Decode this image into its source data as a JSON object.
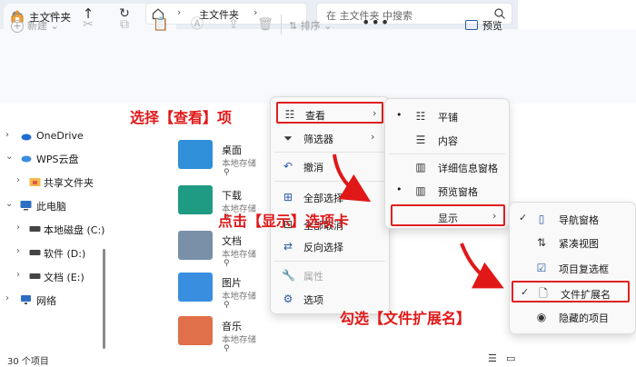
{
  "window": {
    "tab_title": "主文件夹",
    "tab_close": "✕",
    "new_tab": "+",
    "min": "—",
    "max": "☐",
    "close": "✕"
  },
  "address": {
    "back": "←",
    "forward": "→",
    "up": "↑",
    "refresh": "↻",
    "separator": "›",
    "breadcrumb": "主文件夹",
    "search_placeholder": "在 主文件夹 中搜索"
  },
  "toolbar": {
    "new_label": "新建",
    "new_caret": "⌄",
    "sort_label": "排序",
    "sort_caret": "⌄",
    "more": "•••",
    "preview_label": "预览"
  },
  "sidebar": {
    "items": [
      {
        "label": "OneDrive",
        "chevron": "›"
      },
      {
        "label": "WPS云盘",
        "chevron": "⌄"
      },
      {
        "label": "共享文件夹",
        "chevron": "›"
      },
      {
        "label": "此电脑",
        "chevron": "⌄"
      },
      {
        "label": "本地磁盘 (C:)",
        "chevron": "›"
      },
      {
        "label": "软件 (D:)",
        "chevron": "›"
      },
      {
        "label": "文档 (E:)",
        "chevron": "›"
      },
      {
        "label": "网络",
        "chevron": "›"
      }
    ]
  },
  "files": [
    {
      "name": "桌面",
      "location": "本地存储",
      "pin": "📌",
      "color": "#2f8fd8"
    },
    {
      "name": "下载",
      "location": "本地存储",
      "pin": "📌",
      "color": "#1f9a83"
    },
    {
      "name": "文档",
      "location": "本地存储",
      "pin": "📌",
      "color": "#7a8fa8"
    },
    {
      "name": "图片",
      "location": "本地存储",
      "pin": "📌",
      "color": "#3a8ee0"
    },
    {
      "name": "音乐",
      "location": "本地存储",
      "pin": "📌",
      "color": "#e0704a"
    }
  ],
  "status": {
    "count": "30 个项目",
    "view_details": "☰",
    "view_tiles": "▭"
  },
  "menu1": {
    "items": [
      {
        "label": "查看",
        "icon": "☷",
        "arrow": "›"
      },
      {
        "label": "筛选器",
        "icon": "⏷",
        "arrow": "›"
      },
      {
        "label": "撤消",
        "icon": "↶",
        "arrow": ""
      },
      {
        "label": "全部选择",
        "icon": "⊞",
        "arrow": ""
      },
      {
        "label": "全部取消",
        "icon": "⊟",
        "arrow": ""
      },
      {
        "label": "反向选择",
        "icon": "⇄",
        "arrow": ""
      },
      {
        "label": "属性",
        "icon": "🔧",
        "arrow": ""
      },
      {
        "label": "选项",
        "icon": "⚙",
        "arrow": ""
      }
    ]
  },
  "menu2": {
    "items": [
      {
        "label": "平铺",
        "icon": "☷",
        "mark": "•"
      },
      {
        "label": "内容",
        "icon": "☰",
        "mark": ""
      },
      {
        "label": "详细信息窗格",
        "icon": "▥",
        "mark": ""
      },
      {
        "label": "预览窗格",
        "icon": "▥",
        "mark": "•"
      },
      {
        "label": "显示",
        "icon": "",
        "mark": "",
        "arrow": "›"
      }
    ]
  },
  "menu3": {
    "items": [
      {
        "label": "导航窗格",
        "icon": "▯",
        "mark": "✓"
      },
      {
        "label": "紧凑视图",
        "icon": "⇅",
        "mark": ""
      },
      {
        "label": "项目复选框",
        "icon": "☑",
        "mark": ""
      },
      {
        "label": "文件扩展名",
        "icon": "🗋",
        "mark": "✓"
      },
      {
        "label": "隐藏的项目",
        "icon": "◉",
        "mark": ""
      }
    ]
  },
  "annotations": {
    "step1": "选择【查看】项",
    "step2": "点击【显示】选项卡",
    "step3": "勾选【文件扩展名】"
  },
  "colors": {
    "annotation_red": "#e01818",
    "accent_blue": "#2a5aa8"
  }
}
